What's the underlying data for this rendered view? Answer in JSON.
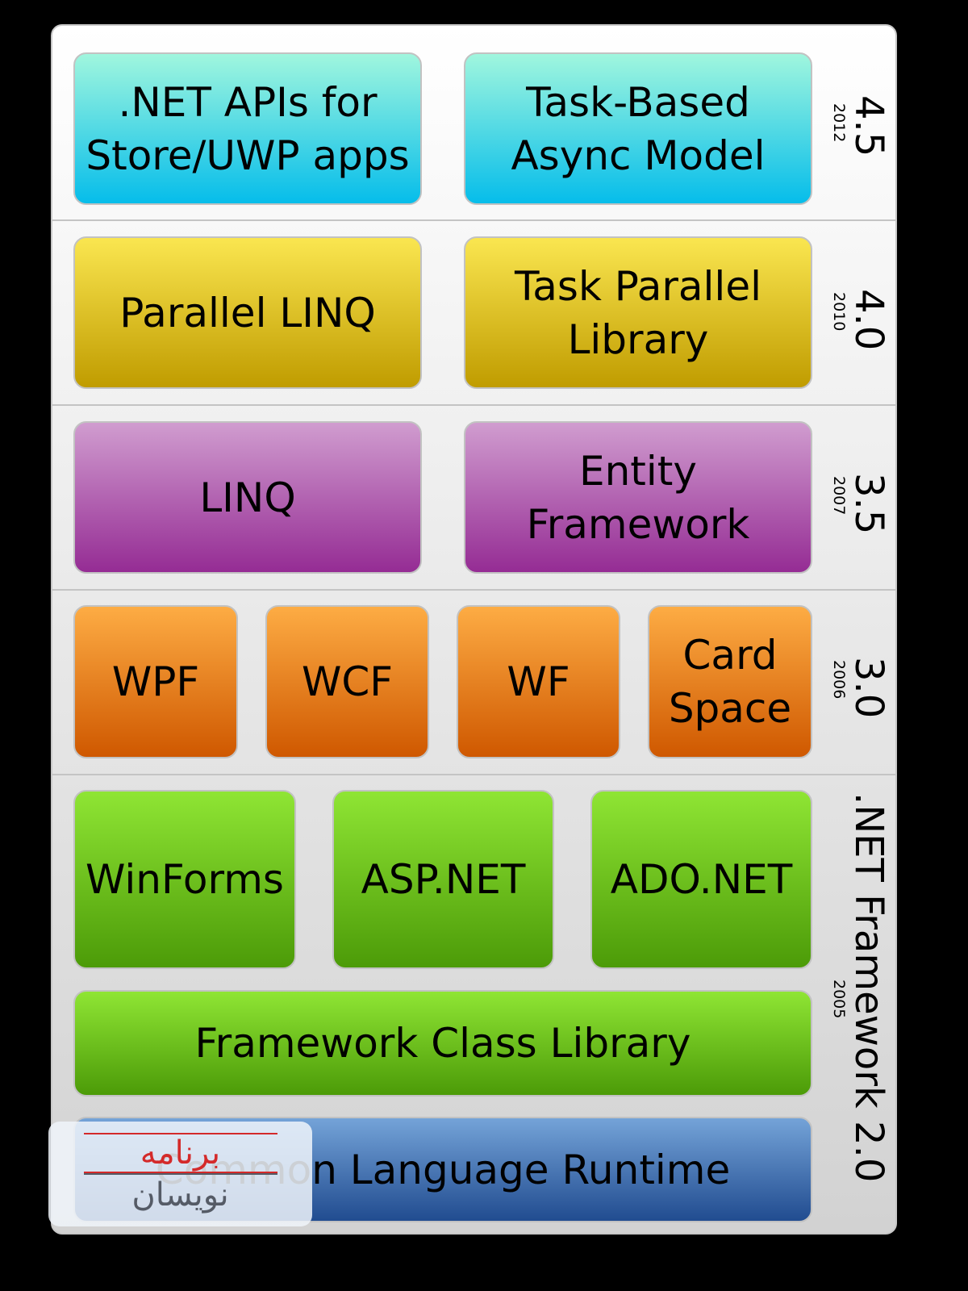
{
  "rows": [
    {
      "version": "4.5",
      "year": "2012",
      "boxes": [
        ".NET APIs for\nStore/UWP apps",
        "Task-Based\nAsync Model"
      ]
    },
    {
      "version": "4.0",
      "year": "2010",
      "boxes": [
        "Parallel LINQ",
        "Task Parallel\nLibrary"
      ]
    },
    {
      "version": "3.5",
      "year": "2007",
      "boxes": [
        "LINQ",
        "Entity\nFramework"
      ]
    },
    {
      "version": "3.0",
      "year": "2006",
      "boxes": [
        "WPF",
        "WCF",
        "WF",
        "Card\nSpace"
      ]
    },
    {
      "version": ".NET Framework 2.0",
      "year": "2005",
      "boxes": [
        "WinForms",
        "ASP.NET",
        "ADO.NET",
        "Framework Class Library",
        "Common Language Runtime"
      ]
    }
  ],
  "colors": {
    "4.5": "#06bdea",
    "4.0": "#c09c00",
    "3.5": "#952c94",
    "3.0": "#cf5800",
    "2.0": "#4c9b08",
    "clr": "#214c90"
  },
  "watermark": {
    "line1": "برنامه",
    "line2": "نویسان"
  }
}
